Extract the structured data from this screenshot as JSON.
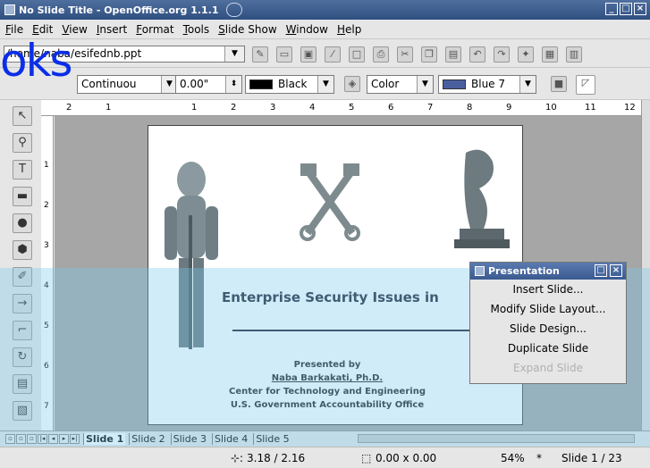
{
  "window": {
    "title": "No Slide Title - OpenOffice.org 1.1.1"
  },
  "menu": [
    "File",
    "Edit",
    "View",
    "Insert",
    "Format",
    "Tools",
    "Slide Show",
    "Window",
    "Help"
  ],
  "toolbar": {
    "path": "/home/naba/esifednb.ppt"
  },
  "formatting": {
    "line_style": "Continuou",
    "line_width": "0.00\"",
    "line_color": "Black",
    "fill_type": "Color",
    "fill_color": "Blue 7"
  },
  "watermark": "oks",
  "ruler": {
    "h_ticks": [
      "2",
      "1",
      "1",
      "2",
      "3",
      "4",
      "5",
      "6",
      "7",
      "8",
      "9",
      "10",
      "11",
      "12"
    ],
    "v_ticks": [
      "1",
      "2",
      "3",
      "4",
      "5",
      "6",
      "7"
    ]
  },
  "slide": {
    "title": "Enterprise Security Issues in",
    "presented_by": "Presented by",
    "presenter": "Naba Barkakati, Ph.D.",
    "org1": "Center for Technology and Engineering",
    "org2": "U.S. Government Accountability Office"
  },
  "popup": {
    "title": "Presentation",
    "items": [
      "Insert Slide...",
      "Modify Slide Layout...",
      "Slide Design...",
      "Duplicate Slide",
      "Expand Slide"
    ]
  },
  "tabs": [
    "Slide 1",
    "Slide 2",
    "Slide 3",
    "Slide 4",
    "Slide 5"
  ],
  "status": {
    "position": "3.18 / 2.16",
    "size": "0.00 x 0.00",
    "zoom": "54%",
    "slide": "Slide 1 / 23"
  },
  "colors": {
    "black": "#000000",
    "blue7": "#4a5f9e",
    "title_bar": "#2f4f80"
  }
}
